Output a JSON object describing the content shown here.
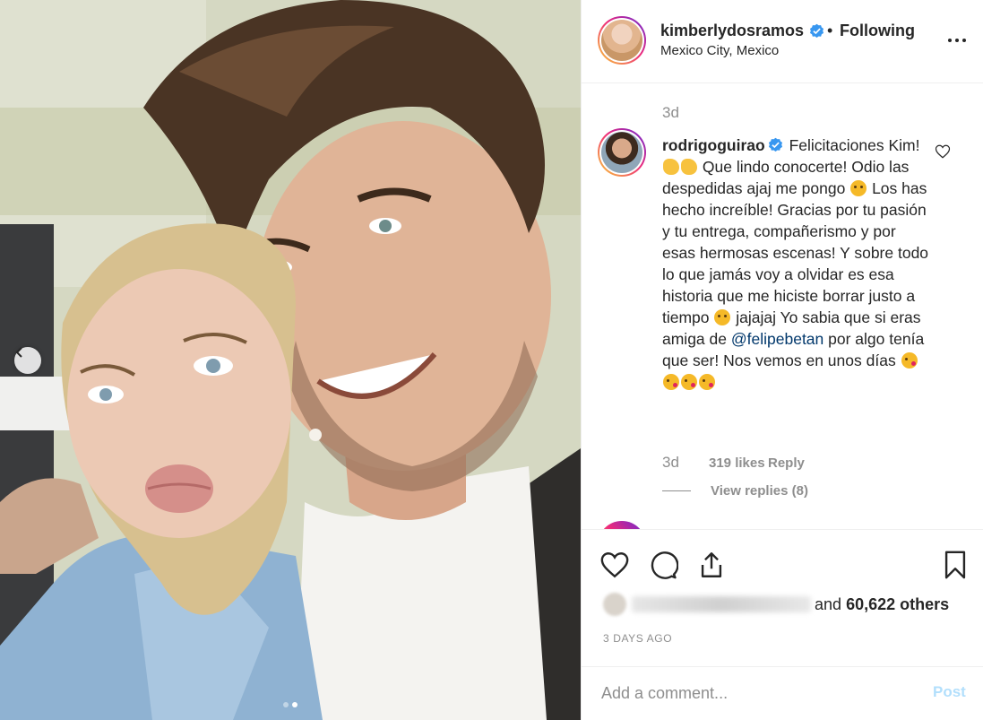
{
  "post": {
    "username": "kimberlydosramos",
    "separator": "•",
    "follow_status": "Following",
    "location": "Mexico City, Mexico",
    "verified": true
  },
  "comments": {
    "previous_time": "3d",
    "items": [
      {
        "username": "rodrigoguirao",
        "verified": true,
        "text_parts": [
          "Felicitaciones Kim!",
          "Que lindo conocerte! Odio las despedidas ajaj me pongo",
          "Los has hecho increíble! Gracias por tu pasión y tu entrega, compañerismo y por esas hermosas escenas! Y sobre todo lo que jamás voy a olvidar es esa historia que me hiciste borrar justo a tiempo",
          "jajajaj Yo sabia que si eras amiga de",
          "@felipebetan",
          "por algo tenía que ser! Nos vemos en unos días"
        ],
        "emojis": [
          "clapping-hands",
          "clapping-hands",
          "sad-face",
          "worried-face",
          "kissing-face",
          "kissing-face",
          "kissing-face",
          "kissing-face"
        ],
        "time": "3d",
        "likes": "319 likes",
        "reply_label": "Reply",
        "view_replies": "View replies (8)"
      }
    ]
  },
  "actions": {
    "like_icon": "heart-outline-icon",
    "comment_icon": "speech-bubble-icon",
    "share_icon": "share-upload-icon",
    "save_icon": "bookmark-icon",
    "likes_prefix": "and",
    "likes_count": "60,622 others",
    "date": "3 DAYS AGO"
  },
  "comment_box": {
    "placeholder": "Add a comment...",
    "post_label": "Post"
  },
  "carousel": {
    "total": 2,
    "active_index": 1
  },
  "colors": {
    "verified_blue": "#3897f0",
    "post_disabled": "#b2dffc",
    "mention": "#00376b",
    "secondary_text": "#8e8e8e"
  }
}
